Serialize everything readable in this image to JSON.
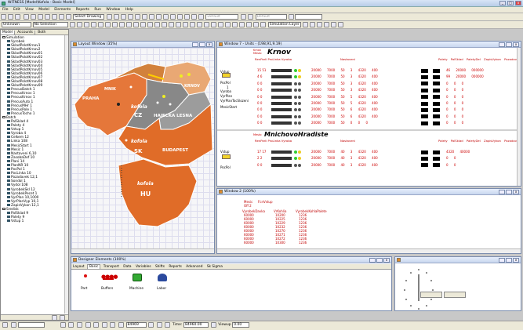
{
  "title_bar": {
    "title": "WITNESS [Model\\Kofola - Basic Model]"
  },
  "menu": [
    "File",
    "Edit",
    "View",
    "Model",
    "Elements",
    "Reports",
    "Run",
    "Window",
    "Help"
  ],
  "toolbar": {
    "select_drawing": "Select Drawing",
    "default1": "Default",
    "default2": "Default",
    "unknown": "Unknown",
    "no_selection": "No Selection",
    "simulation_layer": "Simulation Layer"
  },
  "left_tabs": [
    "Model",
    "Accounts",
    "Both"
  ],
  "tree": [
    {
      "t": "Simulation",
      "d": 0
    },
    {
      "t": "Vyrobek",
      "d": 1
    },
    {
      "t": "SkladPolotKrnov1",
      "d": 1
    },
    {
      "t": "SkladPolotKrnov2",
      "d": 1
    },
    {
      "t": "SkladPolotKrnov01",
      "d": 1
    },
    {
      "t": "SkladPolotKrnov02",
      "d": 1
    },
    {
      "t": "SkladPolotKrnov03",
      "d": 1
    },
    {
      "t": "SkladPolotKrnov04",
      "d": 1
    },
    {
      "t": "SkladPolotKrnov05",
      "d": 1
    },
    {
      "t": "SkladPolotKrnov06",
      "d": 1
    },
    {
      "t": "SkladPolotKrnov07",
      "d": 1
    },
    {
      "t": "SkladPolotKrnov08",
      "d": 1
    },
    {
      "t": "SkladPolotKrnov09",
      "d": 1
    },
    {
      "t": "PrecusBatch 1",
      "d": 1
    },
    {
      "t": "PrecusKrnov 1",
      "d": 1
    },
    {
      "t": "PrecusKrnov 1",
      "d": 1
    },
    {
      "t": "PrecusAuto 1",
      "d": 1
    },
    {
      "t": "PrecusMHr 1",
      "d": 1
    },
    {
      "t": "PrecusPole 1",
      "d": 1
    },
    {
      "t": "PrecusTocho 1",
      "d": 1
    },
    {
      "t": "Batch",
      "d": 0
    },
    {
      "t": "PalSklad 4",
      "d": 1
    },
    {
      "t": "Palety 4",
      "d": 1
    },
    {
      "t": "Vstup 1",
      "d": 1
    },
    {
      "t": "Vyroba 4",
      "d": 1
    },
    {
      "t": "Celkem 12",
      "d": 1
    },
    {
      "t": "Linka 108",
      "d": 1
    },
    {
      "t": "MesicStart 1",
      "d": 1
    },
    {
      "t": "Mesic 1",
      "d": 1
    },
    {
      "t": "Nastaveni 6,10",
      "d": 1
    },
    {
      "t": "ZasobaDef 10",
      "d": 1
    },
    {
      "t": "Plani 14",
      "d": 1
    },
    {
      "t": "PlanNR 10",
      "d": 1
    },
    {
      "t": "PocPol 1",
      "d": 1
    },
    {
      "t": "PocLinka 10",
      "d": 1
    },
    {
      "t": "Pozadavek 12,1",
      "d": 1
    },
    {
      "t": "Sondol 1",
      "d": 1
    },
    {
      "t": "Vydol 108",
      "d": 1
    },
    {
      "t": "VyrobekSkl 12",
      "d": 1
    },
    {
      "t": "VyrobekPecet 1",
      "d": 1
    },
    {
      "t": "VyrPlan 10,1000",
      "d": 1
    },
    {
      "t": "VyrPlanVyp 10,1",
      "d": 1
    },
    {
      "t": "ZapisVykon 12,1",
      "d": 1
    },
    {
      "t": "Sredisk",
      "d": 0
    },
    {
      "t": "PalSklad 9",
      "d": 1
    },
    {
      "t": "Palety 9",
      "d": 1
    },
    {
      "t": "Vstup 1",
      "d": 1
    }
  ],
  "layout_window": {
    "title": "Layout Window (35%)",
    "labels": {
      "mnik": "MNIK",
      "praha": "PRAHA",
      "krnov": "KRNOV",
      "hajecka": "HAJECKA LESNA",
      "budapest": "BUDAPEST",
      "cz": "CZ",
      "sk": "SK",
      "hu": "HU",
      "kofola1": "kofola",
      "kofola2": "kofola",
      "kofola3": "kofola"
    }
  },
  "window7": {
    "title": "Window 7 - Units - (198,91,9.19)",
    "krnov_title": "Krnov",
    "krnov_small": "Krnov\nMesto",
    "mn_title": "MnichovoHradiste",
    "cols1": "RenParli ProLinka Vyroba",
    "nastaveni": "Nastaveni",
    "cols2": [
      "Palety",
      "PalSklad",
      "PaletyDel",
      "ZapisVykon",
      "Pozadavek"
    ],
    "left_labels": [
      "Vstup",
      "PocPol",
      "1",
      "Vyroba",
      "VyrPlan",
      "VyrPlanTocSlozeni",
      "MesicStart"
    ],
    "vyroba_vals": [
      "Vyroba",
      "Sumi"
    ],
    "rows": [
      {
        "a": "15 51",
        "n": "20000 7000 50 3 4320 400",
        "p": "46 20000 000000"
      },
      {
        "a": "4 6",
        "n": "20000 7000 50 3 4320 400",
        "p": "99 20000 000000"
      },
      {
        "a": "0 0",
        "n": "20000 7000 50 3 4320 400",
        "p": "0 0 0"
      },
      {
        "a": "0 0",
        "n": "20000 7000 50 3 4320 400",
        "p": "0 0 0"
      },
      {
        "a": "0 0",
        "n": "20000 7000 50 5 4320 400",
        "p": "0 0 0"
      },
      {
        "a": "0 0",
        "n": "20000 7000 50 5 4320 400",
        "p": "0 0 0"
      },
      {
        "a": "0 0",
        "n": "20000 7000 50 6 4320 400",
        "p": "0 0 0"
      },
      {
        "a": "0 0",
        "n": "20000 7000 50 6 4320 400",
        "p": "0 0 0"
      },
      {
        "a": "0 0",
        "n": "20000 7000 50 0 0 0",
        "p": "0 0 0"
      }
    ],
    "rows2": [
      {
        "a": "17 17",
        "n": "20000 7000 40 3 4320 400",
        "p": "4320 40000"
      },
      {
        "a": "2 2",
        "n": "20000 7000 40 3 4320 400",
        "p": "0 0"
      },
      {
        "a": "0 0",
        "n": "20000 7000 40 3 4320 400",
        "p": "0 0"
      }
    ]
  },
  "window2": {
    "title": "Window 2 (100%)",
    "mesic_label": "Mesic",
    "mesic_val": "FcnVstup",
    "off": "Off 2",
    "headers": [
      "VyrobekDavka",
      "VrKohlia",
      "VyrobekKohlaPalete"
    ],
    "rows": [
      [
        "60000",
        "10200",
        "1236"
      ],
      [
        "60000",
        "10225",
        "1236"
      ],
      [
        "60000",
        "10229",
        "1236"
      ],
      [
        "60000",
        "10232",
        "1236"
      ],
      [
        "60000",
        "10270",
        "1236"
      ],
      [
        "60000",
        "10271",
        "1236"
      ],
      [
        "60000",
        "10272",
        "1236"
      ],
      [
        "60000",
        "10300",
        "1236"
      ]
    ]
  },
  "designer": {
    "title": "Designer Elements (100%)",
    "tabs": [
      "Layout",
      "Basic",
      "Transport",
      "Data",
      "Variables",
      "Shifts",
      "Reports",
      "Advanced",
      "Sk Sigma"
    ],
    "items": [
      "Part",
      "Buffers",
      "Machine",
      "Labor"
    ]
  },
  "status": {
    "field1": "",
    "time_label": "Time:",
    "time_val": "84960.00",
    "viewup_label": "Viewup",
    "viewup_val": "0.00",
    "clock_val": "84969"
  }
}
